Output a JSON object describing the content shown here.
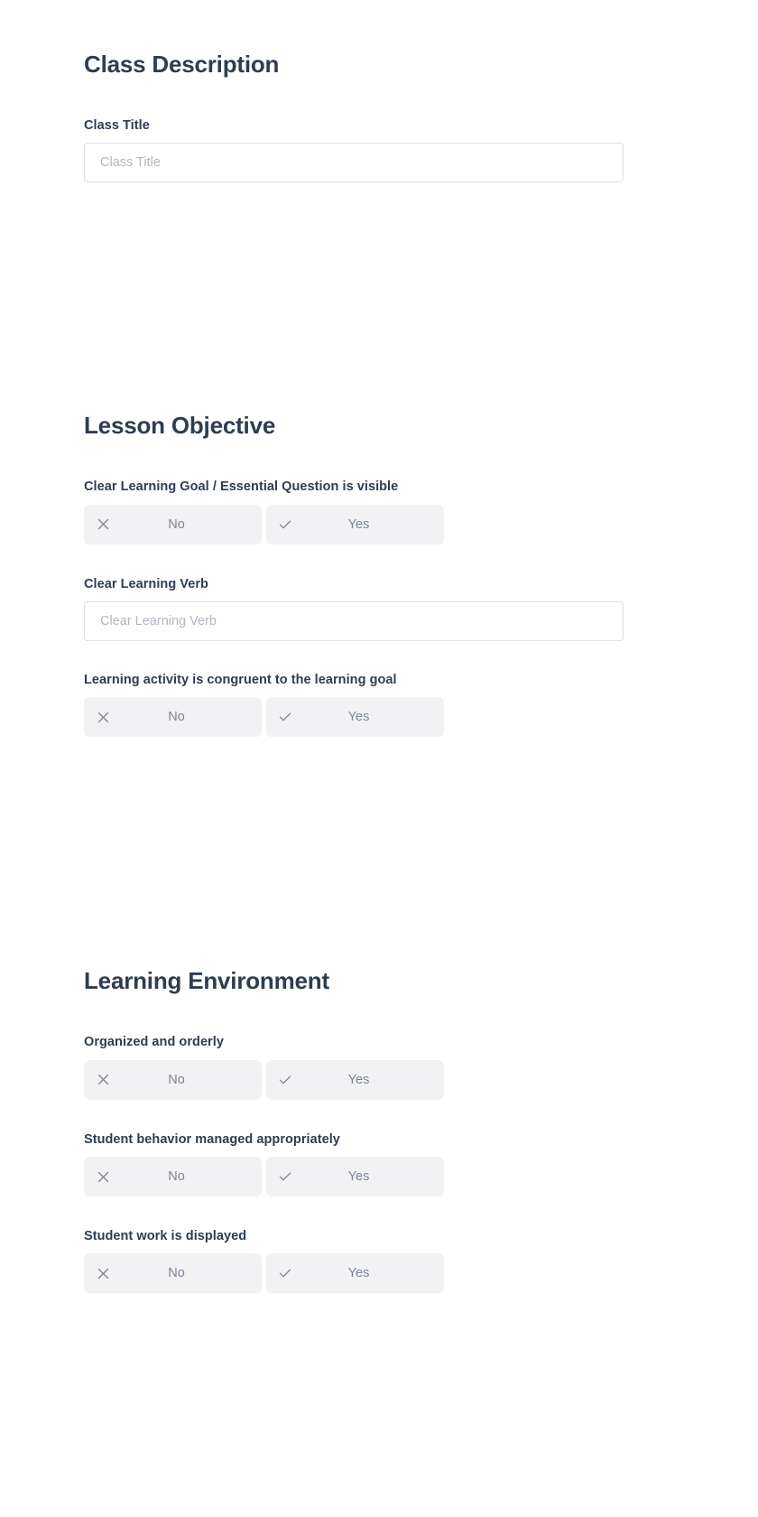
{
  "form": {
    "sections": [
      {
        "id": "class-description",
        "title": "Class Description",
        "fields": [
          {
            "id": "class-title",
            "type": "text",
            "label": "Class Title",
            "value": "",
            "placeholder": "Class Title"
          }
        ]
      },
      {
        "id": "lesson-objective",
        "title": "Lesson Objective",
        "fields": [
          {
            "id": "clear-learning-goal",
            "type": "toggle",
            "label": "Clear Learning Goal / Essential Question is visible",
            "options": [
              {
                "value": "no",
                "label": "No",
                "icon": "close-icon"
              },
              {
                "value": "yes",
                "label": "Yes",
                "icon": "check-icon"
              }
            ],
            "selected": ""
          },
          {
            "id": "clear-learning-verb",
            "type": "text",
            "label": "Clear Learning Verb",
            "value": "",
            "placeholder": "Clear Learning Verb"
          },
          {
            "id": "learning-activity-congruent",
            "type": "toggle",
            "label": "Learning activity is congruent to the learning goal",
            "options": [
              {
                "value": "no",
                "label": "No",
                "icon": "close-icon"
              },
              {
                "value": "yes",
                "label": "Yes",
                "icon": "check-icon"
              }
            ],
            "selected": ""
          }
        ]
      },
      {
        "id": "learning-environment",
        "title": "Learning Environment",
        "fields": [
          {
            "id": "organized-and-orderly",
            "type": "toggle",
            "label": "Organized and orderly",
            "options": [
              {
                "value": "no",
                "label": "No",
                "icon": "close-icon"
              },
              {
                "value": "yes",
                "label": "Yes",
                "icon": "check-icon"
              }
            ],
            "selected": ""
          },
          {
            "id": "student-behavior-managed",
            "type": "toggle",
            "label": "Student behavior managed appropriately",
            "options": [
              {
                "value": "no",
                "label": "No",
                "icon": "close-icon"
              },
              {
                "value": "yes",
                "label": "Yes",
                "icon": "check-icon"
              }
            ],
            "selected": ""
          },
          {
            "id": "student-work-displayed",
            "type": "toggle",
            "label": "Student work is displayed",
            "options": [
              {
                "value": "no",
                "label": "No",
                "icon": "close-icon"
              },
              {
                "value": "yes",
                "label": "Yes",
                "icon": "check-icon"
              }
            ],
            "selected": ""
          }
        ]
      }
    ]
  },
  "colors": {
    "page_background": "#ffffff",
    "heading_text": "#2e3d50",
    "label_text": "#2e3d50",
    "muted_text": "#7c8595",
    "placeholder_text": "#b3b6bf",
    "input_border": "#dfe0e5",
    "toggle_background": "#f2f2f4"
  }
}
